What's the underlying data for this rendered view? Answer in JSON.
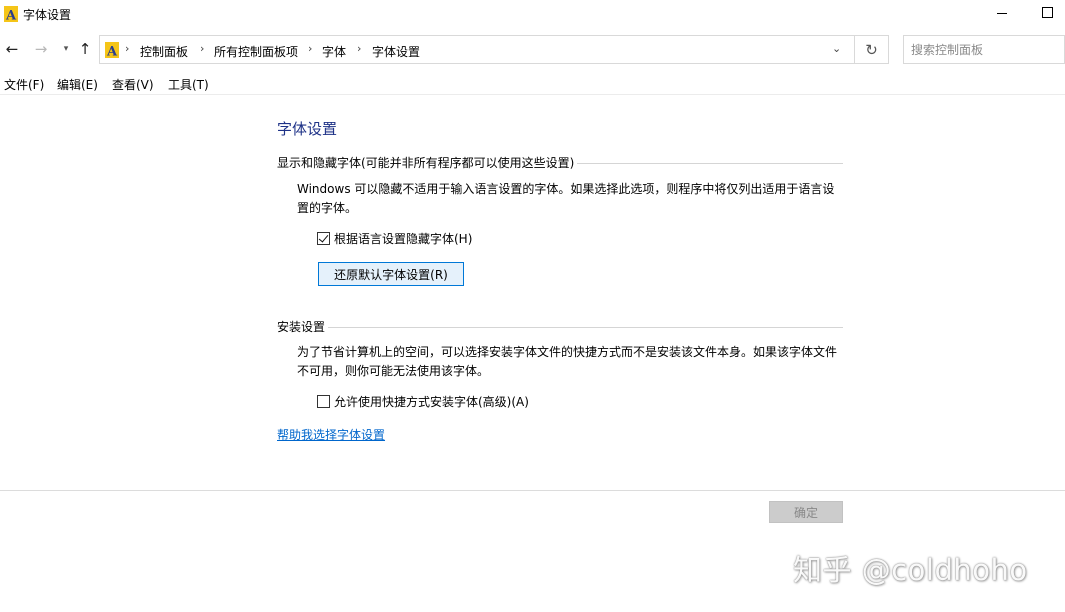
{
  "window": {
    "title": "字体设置"
  },
  "nav": {
    "breadcrumb": [
      "控制面板",
      "所有控制面板项",
      "字体",
      "字体设置"
    ],
    "search_placeholder": "搜索控制面板"
  },
  "menu": {
    "items": [
      "文件(F)",
      "编辑(E)",
      "查看(V)",
      "工具(T)"
    ]
  },
  "page": {
    "title": "字体设置",
    "show_hide_section": {
      "header": "显示和隐藏字体(可能并非所有程序都可以使用这些设置)",
      "description": "Windows 可以隐藏不适用于输入语言设置的字体。如果选择此选项，则程序中将仅列出适用于语言设置的字体。",
      "checkbox_label": "根据语言设置隐藏字体(H)",
      "checkbox_checked": true,
      "restore_button": "还原默认字体设置(R)"
    },
    "install_section": {
      "header": "安装设置",
      "description": "为了节省计算机上的空间，可以选择安装字体文件的快捷方式而不是安装该文件本身。如果该字体文件不可用，则你可能无法使用该字体。",
      "checkbox_label": "允许使用快捷方式安装字体(高级)(A)",
      "checkbox_checked": false
    },
    "help_link": "帮助我选择字体设置",
    "ok_button": "确定"
  },
  "watermark": "知乎 @coldhoho",
  "colors": {
    "title_blue": "#1e3287",
    "link_blue": "#0066cc",
    "button_accent": "#0078d7",
    "icon_yellow": "#f5c518"
  },
  "icons": {
    "app": "font-icon",
    "back": "arrow-left-icon",
    "forward": "arrow-right-icon",
    "recent": "chevron-down-icon",
    "up": "arrow-up-icon",
    "refresh": "refresh-icon",
    "address_dropdown": "chevron-down-icon"
  }
}
